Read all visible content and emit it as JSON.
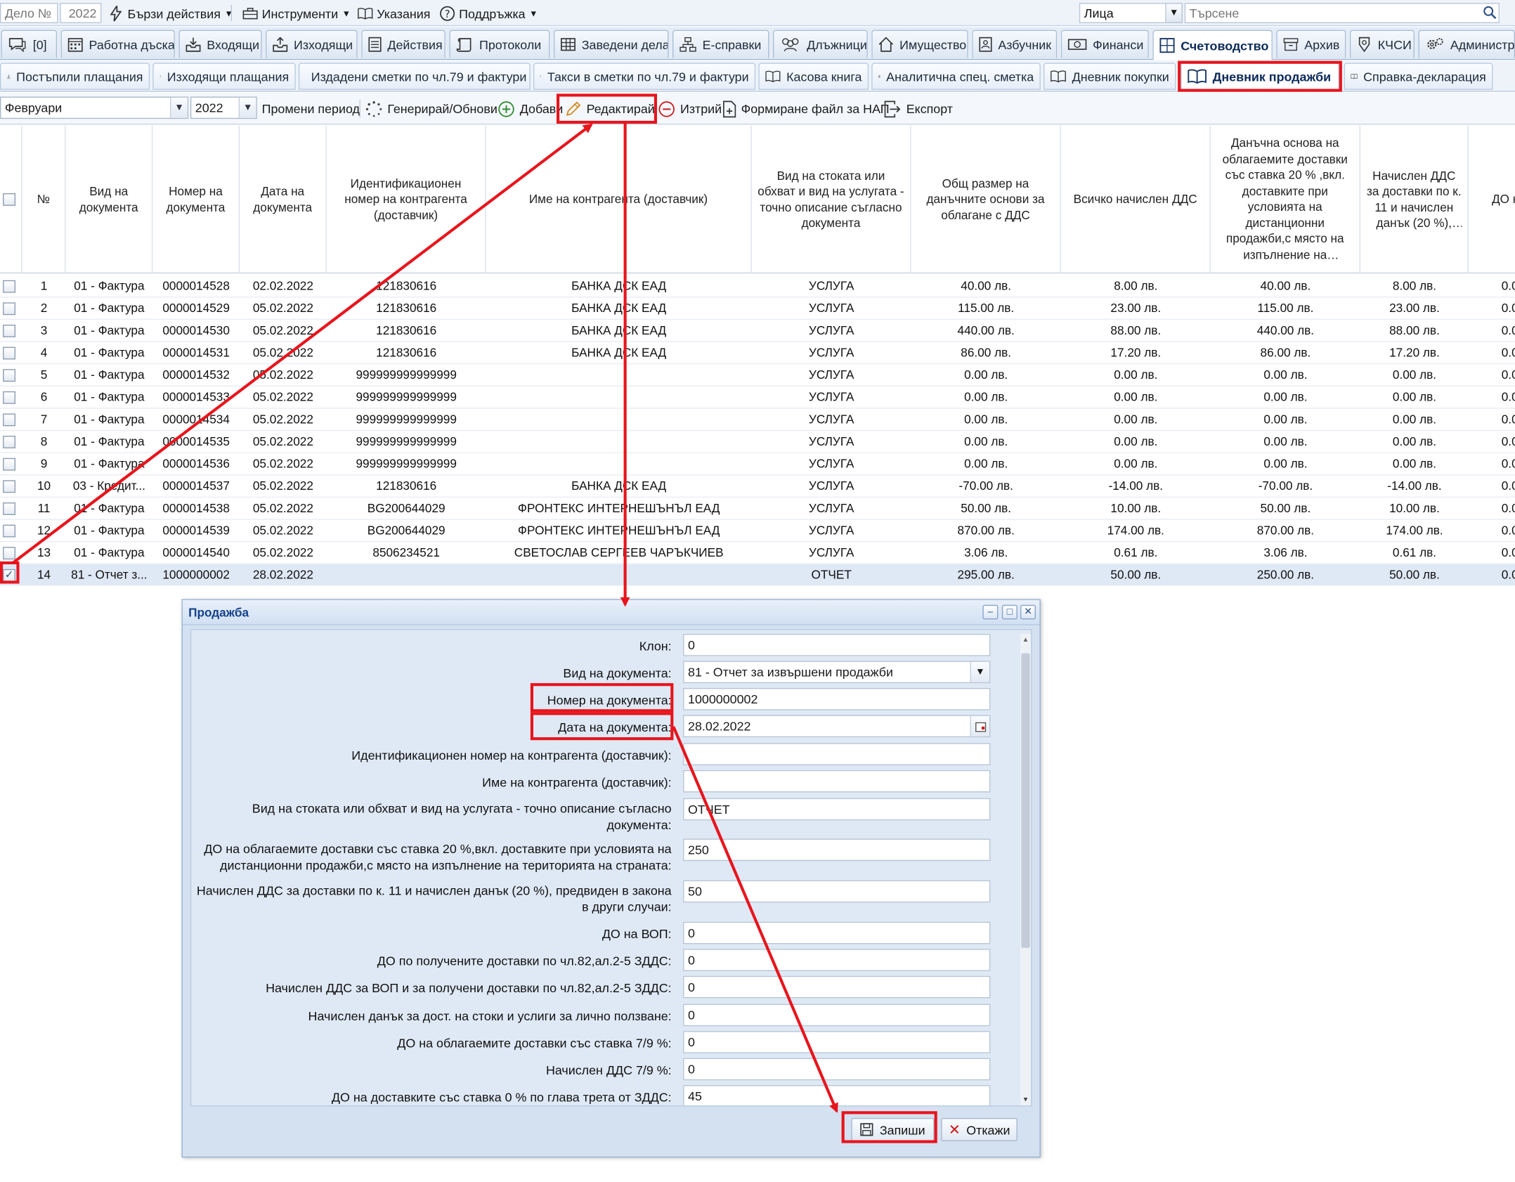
{
  "topbar": {
    "case_placeholder": "Дело №",
    "year": "2022",
    "quick_actions": "Бързи действия",
    "tools": "Инструменти",
    "instructions": "Указания",
    "support": "Поддръжка",
    "entity_select": "Лица",
    "search_placeholder": "Търсене"
  },
  "nav_tabs": [
    {
      "label": "[0]",
      "icon": "chat-icon"
    },
    {
      "label": "Работна дъска",
      "icon": "calendar-icon"
    },
    {
      "label": "Входящи",
      "icon": "inbox-in-icon"
    },
    {
      "label": "Изходящи",
      "icon": "inbox-out-icon"
    },
    {
      "label": "Действия",
      "icon": "list-icon"
    },
    {
      "label": "Протоколи",
      "icon": "scroll-icon"
    },
    {
      "label": "Заведени дела",
      "icon": "table-icon"
    },
    {
      "label": "Е-справки",
      "icon": "sitemap-icon"
    },
    {
      "label": "Длъжници",
      "icon": "people-icon"
    },
    {
      "label": "Имущество",
      "icon": "house-icon"
    },
    {
      "label": "Азбучник",
      "icon": "contact-book-icon"
    },
    {
      "label": "Финанси",
      "icon": "money-icon"
    },
    {
      "label": "Счетоводство",
      "icon": "grid-icon"
    },
    {
      "label": "Архив",
      "icon": "archive-icon"
    },
    {
      "label": "КЧСИ",
      "icon": "badge-icon"
    },
    {
      "label": "Администрация",
      "icon": "gears-icon"
    }
  ],
  "sub_tabs": [
    {
      "label": "Постъпили плащания",
      "icon": "arrow-down-icon"
    },
    {
      "label": "Изходящи плащания",
      "icon": "arrow-up-icon"
    },
    {
      "label": "Издадени сметки по чл.79 и фактури",
      "icon": "dollar-doc-icon"
    },
    {
      "label": "Такси в сметки по чл.79 и фактури",
      "icon": "dollar-doc-icon"
    },
    {
      "label": "Касова книга",
      "icon": "book-icon"
    },
    {
      "label": "Аналитична спец. сметка",
      "icon": "bar-doc-icon"
    },
    {
      "label": "Дневник покупки",
      "icon": "book-icon"
    },
    {
      "label": "Дневник продажби",
      "icon": "book-icon"
    },
    {
      "label": "Справка-декларация",
      "icon": "book-icon"
    }
  ],
  "toolbar": {
    "month": "Февруари",
    "year": "2022",
    "change_period": "Промени период",
    "generate": "Генерирай/Обнови",
    "add": "Добави",
    "edit": "Редактирай",
    "delete": "Изтрий",
    "nap_file": "Формиране файл за НАП",
    "export": "Експорт"
  },
  "grid": {
    "columns": [
      "№",
      "Вид на документа",
      "Номер на документа",
      "Дата на документа",
      "Идентификационен номер на контрагента (доставчик)",
      "Име на контрагента (доставчик)",
      "Вид на стоката или обхват и вид на услугата - точно описание съгласно документа",
      "Общ размер на данъчните основи за облагане с ДДС",
      "Всичко начислен ДДС",
      "Данъчна основа на облагаемите доставки със ставка 20 % ,вкл. доставките при условията на дистанционни продажби,с място на изпълнение на територията на страната",
      "Начислен ДДС за доставки по к. 11 и начислен данък (20 %), предвиден в закона в други случаи",
      "ДО н"
    ],
    "rows": [
      {
        "n": "1",
        "type": "01 - Фактура",
        "num": "0000014528",
        "date": "02.02.2022",
        "id": "121830616",
        "name": "БАНКА ДСК ЕАД",
        "kind": "УСЛУГА",
        "base": "40.00 лв.",
        "vat": "8.00 лв.",
        "base20": "40.00 лв.",
        "vat20": "8.00 лв.",
        "extra": "0.0",
        "checked": false
      },
      {
        "n": "2",
        "type": "01 - Фактура",
        "num": "0000014529",
        "date": "05.02.2022",
        "id": "121830616",
        "name": "БАНКА ДСК ЕАД",
        "kind": "УСЛУГА",
        "base": "115.00 лв.",
        "vat": "23.00 лв.",
        "base20": "115.00 лв.",
        "vat20": "23.00 лв.",
        "extra": "0.0",
        "checked": false
      },
      {
        "n": "3",
        "type": "01 - Фактура",
        "num": "0000014530",
        "date": "05.02.2022",
        "id": "121830616",
        "name": "БАНКА ДСК ЕАД",
        "kind": "УСЛУГА",
        "base": "440.00 лв.",
        "vat": "88.00 лв.",
        "base20": "440.00 лв.",
        "vat20": "88.00 лв.",
        "extra": "0.0",
        "checked": false
      },
      {
        "n": "4",
        "type": "01 - Фактура",
        "num": "0000014531",
        "date": "05.02.2022",
        "id": "121830616",
        "name": "БАНКА ДСК ЕАД",
        "kind": "УСЛУГА",
        "base": "86.00 лв.",
        "vat": "17.20 лв.",
        "base20": "86.00 лв.",
        "vat20": "17.20 лв.",
        "extra": "0.0",
        "checked": false
      },
      {
        "n": "5",
        "type": "01 - Фактура",
        "num": "0000014532",
        "date": "05.02.2022",
        "id": "999999999999999",
        "name": "",
        "kind": "УСЛУГА",
        "base": "0.00 лв.",
        "vat": "0.00 лв.",
        "base20": "0.00 лв.",
        "vat20": "0.00 лв.",
        "extra": "0.0",
        "checked": false
      },
      {
        "n": "6",
        "type": "01 - Фактура",
        "num": "0000014533",
        "date": "05.02.2022",
        "id": "999999999999999",
        "name": "",
        "kind": "УСЛУГА",
        "base": "0.00 лв.",
        "vat": "0.00 лв.",
        "base20": "0.00 лв.",
        "vat20": "0.00 лв.",
        "extra": "0.0",
        "checked": false
      },
      {
        "n": "7",
        "type": "01 - Фактура",
        "num": "0000014534",
        "date": "05.02.2022",
        "id": "999999999999999",
        "name": "",
        "kind": "УСЛУГА",
        "base": "0.00 лв.",
        "vat": "0.00 лв.",
        "base20": "0.00 лв.",
        "vat20": "0.00 лв.",
        "extra": "0.0",
        "checked": false
      },
      {
        "n": "8",
        "type": "01 - Фактура",
        "num": "0000014535",
        "date": "05.02.2022",
        "id": "999999999999999",
        "name": "",
        "kind": "УСЛУГА",
        "base": "0.00 лв.",
        "vat": "0.00 лв.",
        "base20": "0.00 лв.",
        "vat20": "0.00 лв.",
        "extra": "0.0",
        "checked": false
      },
      {
        "n": "9",
        "type": "01 - Фактура",
        "num": "0000014536",
        "date": "05.02.2022",
        "id": "999999999999999",
        "name": "",
        "kind": "УСЛУГА",
        "base": "0.00 лв.",
        "vat": "0.00 лв.",
        "base20": "0.00 лв.",
        "vat20": "0.00 лв.",
        "extra": "0.0",
        "checked": false
      },
      {
        "n": "10",
        "type": "03 - Кредит...",
        "num": "0000014537",
        "date": "05.02.2022",
        "id": "121830616",
        "name": "БАНКА ДСК ЕАД",
        "kind": "УСЛУГА",
        "base": "-70.00 лв.",
        "vat": "-14.00 лв.",
        "base20": "-70.00 лв.",
        "vat20": "-14.00 лв.",
        "extra": "0.0",
        "checked": false
      },
      {
        "n": "11",
        "type": "01 - Фактура",
        "num": "0000014538",
        "date": "05.02.2022",
        "id": "BG200644029",
        "name": "ФРОНТЕКС ИНТЕРНЕШЪНЪЛ ЕАД",
        "kind": "УСЛУГА",
        "base": "50.00 лв.",
        "vat": "10.00 лв.",
        "base20": "50.00 лв.",
        "vat20": "10.00 лв.",
        "extra": "0.0",
        "checked": false
      },
      {
        "n": "12",
        "type": "01 - Фактура",
        "num": "0000014539",
        "date": "05.02.2022",
        "id": "BG200644029",
        "name": "ФРОНТЕКС ИНТЕРНЕШЪНЪЛ ЕАД",
        "kind": "УСЛУГА",
        "base": "870.00 лв.",
        "vat": "174.00 лв.",
        "base20": "870.00 лв.",
        "vat20": "174.00 лв.",
        "extra": "0.0",
        "checked": false
      },
      {
        "n": "13",
        "type": "01 - Фактура",
        "num": "0000014540",
        "date": "05.02.2022",
        "id": "8506234521",
        "name": "СВЕТОСЛАВ СЕРГЕЕВ ЧАРЪКЧИЕВ",
        "kind": "УСЛУГА",
        "base": "3.06 лв.",
        "vat": "0.61 лв.",
        "base20": "3.06 лв.",
        "vat20": "0.61 лв.",
        "extra": "0.0",
        "checked": false
      },
      {
        "n": "14",
        "type": "81 - Отчет з...",
        "num": "1000000002",
        "date": "28.02.2022",
        "id": "",
        "name": "",
        "kind": "ОТЧЕТ",
        "base": "295.00 лв.",
        "vat": "50.00 лв.",
        "base20": "250.00 лв.",
        "vat20": "50.00 лв.",
        "extra": "0.0",
        "checked": true
      }
    ]
  },
  "dialog": {
    "title": "Продажба",
    "fields": [
      {
        "label": "Клон:",
        "value": "0"
      },
      {
        "label": "Вид на документа:",
        "value": "81 - Отчет за извършени продажби"
      },
      {
        "label": "Номер на документа:",
        "value": "1000000002"
      },
      {
        "label": "Дата на документа:",
        "value": "28.02.2022"
      },
      {
        "label": "Идентификационен номер на контрагента (доставчик):",
        "value": ""
      },
      {
        "label": "Име на контрагента (доставчик):",
        "value": ""
      },
      {
        "label": "Вид на стоката или обхват и вид на услугата - точно описание съгласно документа:",
        "value": "ОТЧЕТ"
      },
      {
        "label": "ДО на облагаемите доставки със ставка 20 %,вкл. доставките при условията на дистанционни продажби,с място на изпълнение на територията на страната:",
        "value": "250"
      },
      {
        "label": "Начислен ДДС за доставки по к. 11 и начислен данък (20 %), предвиден в закона в други случаи:",
        "value": "50"
      },
      {
        "label": "ДО на ВОП:",
        "value": "0"
      },
      {
        "label": "ДО по получените доставки по чл.82,ал.2-5 ЗДДС:",
        "value": "0"
      },
      {
        "label": "Начислен ДДС за ВОП и за получени доставки по чл.82,ал.2-5 ЗДДС:",
        "value": "0"
      },
      {
        "label": "Начислен данък за дост. на стоки и услиги за лично ползване:",
        "value": "0"
      },
      {
        "label": "ДО на облагаемите доставки със ставка 7/9 %:",
        "value": "0"
      },
      {
        "label": "Начислен ДДС 7/9 %:",
        "value": "0"
      },
      {
        "label": "ДО на доставките със ставка 0 % по глава трета от ЗДДС:",
        "value": "45"
      }
    ],
    "save_label": "Запиши",
    "cancel_label": "Откажи"
  },
  "colors": {
    "annotation": "#e8141c",
    "dialog_title": "#15428b",
    "active_tab_text": "#0b2a5a"
  }
}
